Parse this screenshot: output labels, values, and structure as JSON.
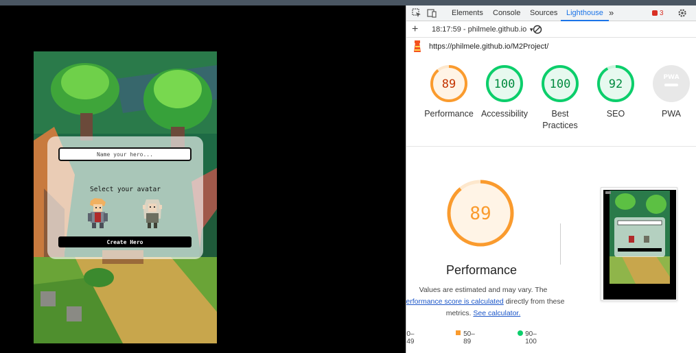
{
  "game": {
    "name_placeholder": "Name your hero...",
    "select_label": "Select your avatar",
    "create_button": "Create Hero",
    "avatars": [
      "warrior-avatar",
      "elf-avatar"
    ]
  },
  "devtools": {
    "tabs": [
      "Elements",
      "Console",
      "Sources",
      "Lighthouse"
    ],
    "active_tab": "Lighthouse",
    "error_count": "3",
    "report_label": "18:17:59 - philmele.github.io",
    "url": "https://philmele.github.io/M2Project/",
    "scores": [
      {
        "label": "Performance",
        "value": "89",
        "num": 89,
        "status": "average"
      },
      {
        "label": "Accessibility",
        "value": "100",
        "num": 100,
        "status": "pass"
      },
      {
        "label": "Best Practices",
        "value": "100",
        "num": 100,
        "status": "pass"
      },
      {
        "label": "SEO",
        "value": "92",
        "num": 92,
        "status": "pass"
      },
      {
        "label": "PWA",
        "value": "",
        "num": 0,
        "status": "na"
      }
    ],
    "detail": {
      "value": "89",
      "num": 89,
      "title": "Performance",
      "desc_prefix": "Values are estimated and may vary. The",
      "desc_link1": "performance score is calculated",
      "desc_mid": "directly from these metrics.",
      "desc_link2": "See calculator."
    },
    "legend": [
      "0–49",
      "50–89",
      "90–100"
    ],
    "colors": {
      "average": "#fa9b2e",
      "pass": "#0cce6b",
      "fail": "#ff4e42",
      "accent": "#1a73e8"
    }
  }
}
